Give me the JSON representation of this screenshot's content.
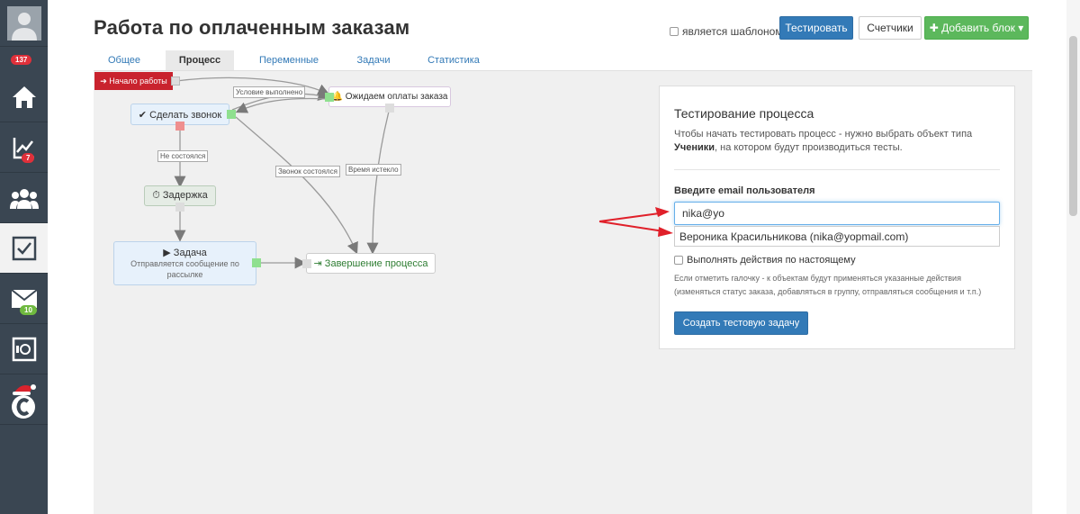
{
  "sidebar": {
    "badges": {
      "main": "137",
      "analytics": "7",
      "messages": "10"
    },
    "icons": [
      "avatar-icon",
      "home-icon",
      "chart-icon",
      "users-icon",
      "checklist-icon",
      "mail-icon",
      "safe-icon",
      "brand-c-icon"
    ]
  },
  "header": {
    "title": "Работа по оплаченным заказам",
    "template_label": "является шаблоном",
    "test_button": "Тестировать",
    "counters_button": "Счетчики",
    "add_block_button": "✚ Добавить блок ▾"
  },
  "tabs": [
    {
      "label": "Общее",
      "active": false
    },
    {
      "label": "Процесс",
      "active": true
    },
    {
      "label": "Переменные",
      "active": false
    },
    {
      "label": "Задачи",
      "active": false
    },
    {
      "label": "Статистика",
      "active": false
    }
  ],
  "flow": {
    "start": "➔ Начало работы",
    "call": "✔ Сделать звонок",
    "await_payment": "🔔 Ожидаем оплаты заказа",
    "delay": "⏱ Задержка",
    "task_title": "▶ Задача",
    "task_desc": "Отправляется сообщение по рассылке",
    "finish": "⇥ Завершение процесса",
    "labels": {
      "condition_met": "Условие выполнено",
      "no_call": "Не состоялся",
      "call_done": "Звонок состоялся",
      "time_expired": "Время истекло"
    }
  },
  "test_panel": {
    "title": "Тестирование процесса",
    "desc_pre": "Чтобы начать тестировать процесс - нужно выбрать объект типа",
    "desc_bold": "Ученики",
    "desc_post": ", на котором будут производиться тесты.",
    "email_label": "Введите email пользователя",
    "email_value": "nika@yo",
    "suggestion": "Вероника Красильникова (nika@yopmail.com)",
    "real_actions_label": "Выполнять действия по настоящему",
    "real_actions_note": "Если отметить галочку - к объектам будут применяться указанные действия (изменяться статус заказа, добавляться в группу, отправляться сообщения и т.п.)",
    "create_button": "Создать тестовую задачу"
  },
  "colors": {
    "sidebar": "#3a4652",
    "primary": "#337ab7",
    "success": "#5cb85c",
    "start_node": "#c9232e",
    "annotation_arrow": "#e0202a"
  }
}
